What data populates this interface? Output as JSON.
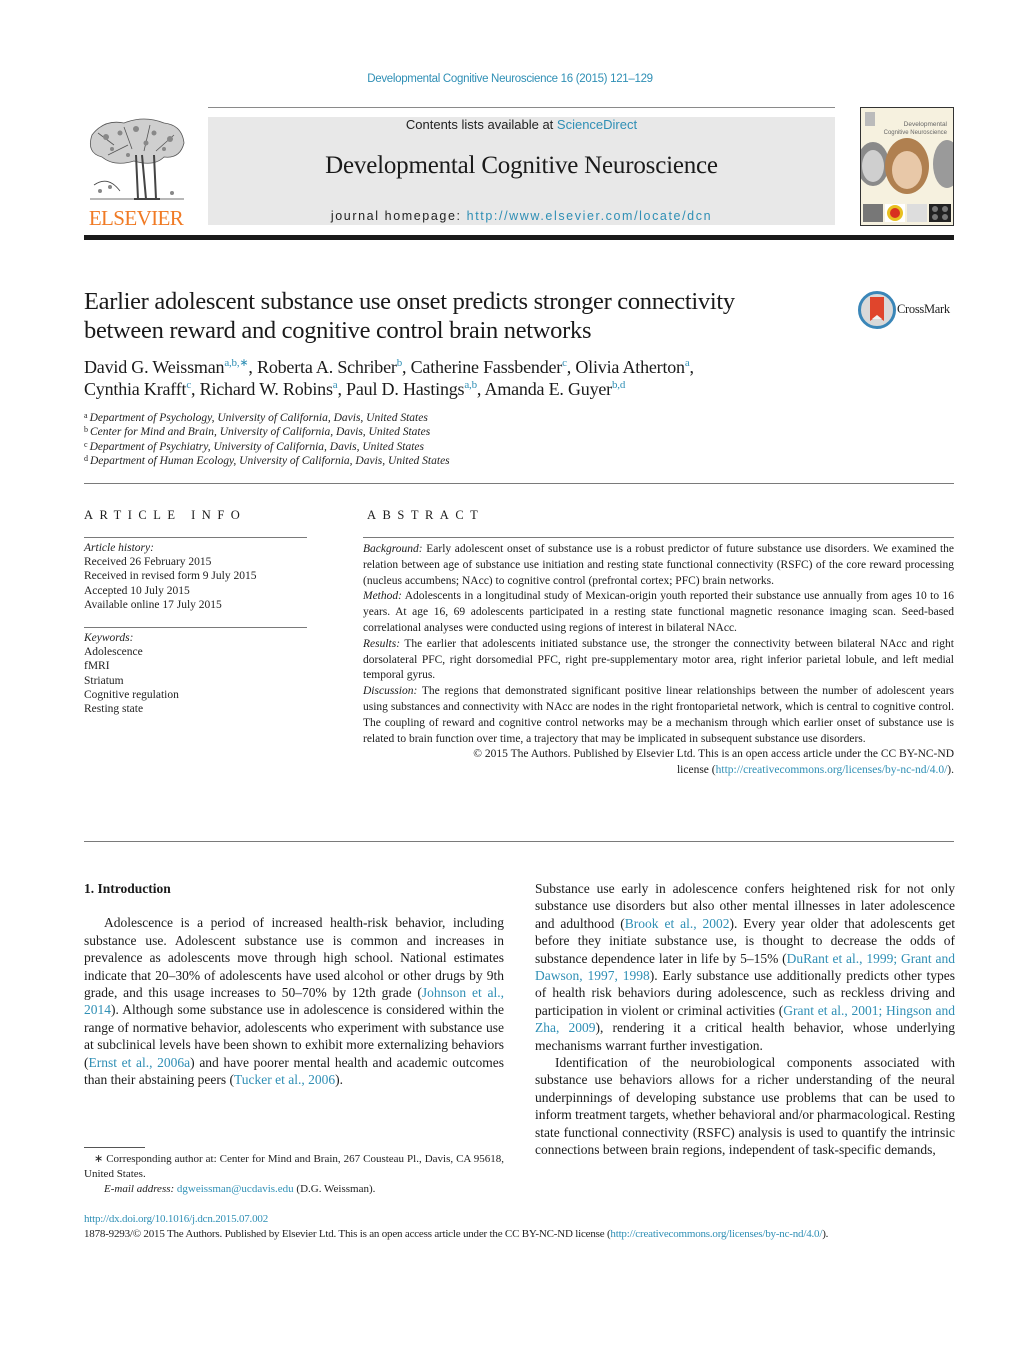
{
  "header": {
    "journal_ref": "Developmental Cognitive Neuroscience 16 (2015) 121–129",
    "contents_prefix": "Contents lists available at ",
    "contents_link": "ScienceDirect",
    "journal_title": "Developmental Cognitive Neuroscience",
    "homepage_prefix": "journal homepage: ",
    "homepage_link": "http://www.elsevier.com/locate/dcn",
    "publisher_logo_text": "ELSEVIER",
    "cover_title_line1": "Developmental",
    "cover_title_line2": "Cognitive Neuroscience",
    "brand_color": "#f07a24",
    "link_color": "#2f8fb5"
  },
  "article": {
    "title_line1": "Earlier adolescent substance use onset predicts stronger connectivity",
    "title_line2": "between reward and cognitive control brain networks",
    "crossmark_label": "CrossMark",
    "authors": [
      {
        "name": "David G. Weissman",
        "sup": "a,b,∗",
        "sep": ", "
      },
      {
        "name": "Roberta A. Schriber",
        "sup": "b",
        "sep": ", "
      },
      {
        "name": "Catherine Fassbender",
        "sup": "c",
        "sep": ", "
      },
      {
        "name": "Olivia Atherton",
        "sup": "a",
        "sep": ","
      },
      {
        "name": "Cynthia Krafft",
        "sup": "c",
        "sep": ", "
      },
      {
        "name": "Richard W. Robins",
        "sup": "a",
        "sep": ", "
      },
      {
        "name": "Paul D. Hastings",
        "sup": "a,b",
        "sep": ", "
      },
      {
        "name": "Amanda E. Guyer",
        "sup": "b,d",
        "sep": ""
      }
    ],
    "affiliations": [
      {
        "key": "a",
        "text": "Department of Psychology, University of California, Davis, United States"
      },
      {
        "key": "b",
        "text": "Center for Mind and Brain, University of California, Davis, United States"
      },
      {
        "key": "c",
        "text": "Department of Psychiatry, University of California, Davis, United States"
      },
      {
        "key": "d",
        "text": "Department of Human Ecology, University of California, Davis, United States"
      }
    ]
  },
  "article_info": {
    "heading": "ARTICLE INFO",
    "history_label": "Article history:",
    "history": [
      "Received 26 February 2015",
      "Received in revised form 9 July 2015",
      "Accepted 10 July 2015",
      "Available online 17 July 2015"
    ],
    "keywords_label": "Keywords:",
    "keywords": [
      "Adolescence",
      "fMRI",
      "Striatum",
      "Cognitive regulation",
      "Resting state"
    ]
  },
  "abstract": {
    "heading": "ABSTRACT",
    "sections": [
      {
        "label": "Background:",
        "text": " Early adolescent onset of substance use is a robust predictor of future substance use disorders. We examined the relation between age of substance use initiation and resting state functional connectivity (RSFC) of the core reward processing (nucleus accumbens; NAcc) to cognitive control (prefrontal cortex; PFC) brain networks."
      },
      {
        "label": "Method:",
        "text": " Adolescents in a longitudinal study of Mexican-origin youth reported their substance use annually from ages 10 to 16 years. At age 16, 69 adolescents participated in a resting state functional magnetic resonance imaging scan. Seed-based correlational analyses were conducted using regions of interest in bilateral NAcc."
      },
      {
        "label": "Results:",
        "text": " The earlier that adolescents initiated substance use, the stronger the connectivity between bilateral NAcc and right dorsolateral PFC, right dorsomedial PFC, right pre-supplementary motor area, right inferior parietal lobule, and left medial temporal gyrus."
      },
      {
        "label": "Discussion:",
        "text": " The regions that demonstrated significant positive linear relationships between the number of adolescent years using substances and connectivity with NAcc are nodes in the right frontoparietal network, which is central to cognitive control. The coupling of reward and cognitive control networks may be a mechanism through which earlier onset of substance use is related to brain function over time, a trajectory that may be implicated in subsequent substance use disorders."
      }
    ],
    "copyright_line1": "© 2015 The Authors. Published by Elsevier Ltd. This is an open access article under the CC BY-NC-ND",
    "copyright_prefix": "license (",
    "copyright_link": "http://creativecommons.org/licenses/by-nc-nd/4.0/",
    "copyright_suffix": ")."
  },
  "body": {
    "section_heading": "1.  Introduction",
    "left_p1_a": "Adolescence is a period of increased health-risk behavior, including substance use. Adolescent substance use is common and increases in prevalence as adolescents move through high school. National estimates indicate that 20–30% of adolescents have used alcohol or other drugs by 9th grade, and this usage increases to 50–70% by 12th grade (",
    "left_cite1": "Johnson et al., 2014",
    "left_p1_b": "). Although some substance use in adolescence is considered within the range of normative behavior, adolescents who experiment with substance use at subclinical levels have been shown to exhibit more externalizing behaviors (",
    "left_cite2": "Ernst et al., 2006a",
    "left_p1_c": ") and have poorer mental health and academic outcomes than their abstaining peers (",
    "left_cite3": "Tucker et al., 2006",
    "left_p1_d": ").",
    "right_p1_a": "Substance use early in adolescence confers heightened risk for not only substance use disorders but also other mental illnesses in later adolescence and adulthood (",
    "right_cite1": "Brook et al., 2002",
    "right_p1_b": "). Every year older that adolescents get before they initiate substance use, is thought to decrease the odds of substance dependence later in life by 5–15% (",
    "right_cite2": "DuRant et al., 1999; Grant and Dawson, 1997, 1998",
    "right_p1_c": "). Early substance use additionally predicts other types of health risk behaviors during adolescence, such as reckless driving and participation in violent or criminal activities (",
    "right_cite3": "Grant et al., 2001; Hingson and Zha, 2009",
    "right_p1_d": "), rendering it a critical health behavior, whose underlying mechanisms warrant further investigation.",
    "right_p2": "Identification of the neurobiological components associated with substance use behaviors allows for a richer understanding of the neural underpinnings of developing substance use problems that can be used to inform treatment targets, whether behavioral and/or pharmacological. Resting state functional connectivity (RSFC) analysis is used to quantify the intrinsic connections between brain regions, independent of task-specific demands,"
  },
  "footnote": {
    "corresponding": "∗  Corresponding author at: Center for Mind and Brain, 267 Cousteau Pl., Davis, CA 95618, United States.",
    "email_label": "E-mail address:",
    "email": "dgweissman@ucdavis.edu",
    "email_suffix": " (D.G. Weissman)."
  },
  "bottom": {
    "doi": "http://dx.doi.org/10.1016/j.dcn.2015.07.002",
    "license_prefix": "1878-9293/© 2015 The Authors. Published by Elsevier Ltd. This is an open access article under the CC BY-NC-ND license (",
    "license_link": "http://creativecommons.org/licenses/by-nc-nd/4.0/",
    "license_suffix": ")."
  }
}
